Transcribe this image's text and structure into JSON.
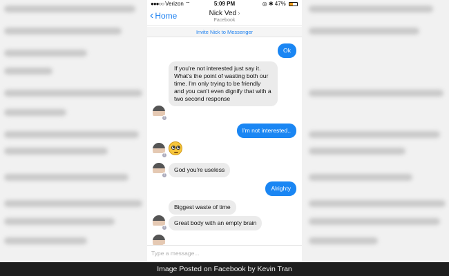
{
  "status_bar": {
    "carrier": "Verizon",
    "time": "5:09 PM",
    "battery": "47%",
    "battery_level": 0.47
  },
  "nav": {
    "back_label": "Home",
    "contact_name": "Nick Ved",
    "subtitle": "Facebook"
  },
  "invite_text": "Invite Nick to Messenger",
  "messages": [
    {
      "sender": "me",
      "text": "Ok"
    },
    {
      "sender": "them",
      "text": "If you're not interested just say it. What's the point of wasting both our time. I'm only trying to be friendly and you can't even dignify that with a two second response"
    },
    {
      "sender": "me",
      "text": "I'm not interested.."
    },
    {
      "sender": "them",
      "text": "",
      "emoji": "eye-roll-emoji"
    },
    {
      "sender": "them",
      "text": "God you're useless"
    },
    {
      "sender": "me",
      "text": "Alrighty"
    },
    {
      "sender": "them",
      "text": "Biggest waste of time"
    },
    {
      "sender": "them",
      "text": "Great body with an empty brain"
    }
  ],
  "composer": {
    "placeholder": "Type a message..."
  },
  "caption": "Image Posted on Facebook by Kevin Tran",
  "colors": {
    "accent": "#1a86f3",
    "incoming": "#ebebeb",
    "caption_bg": "#1e1e1e"
  }
}
